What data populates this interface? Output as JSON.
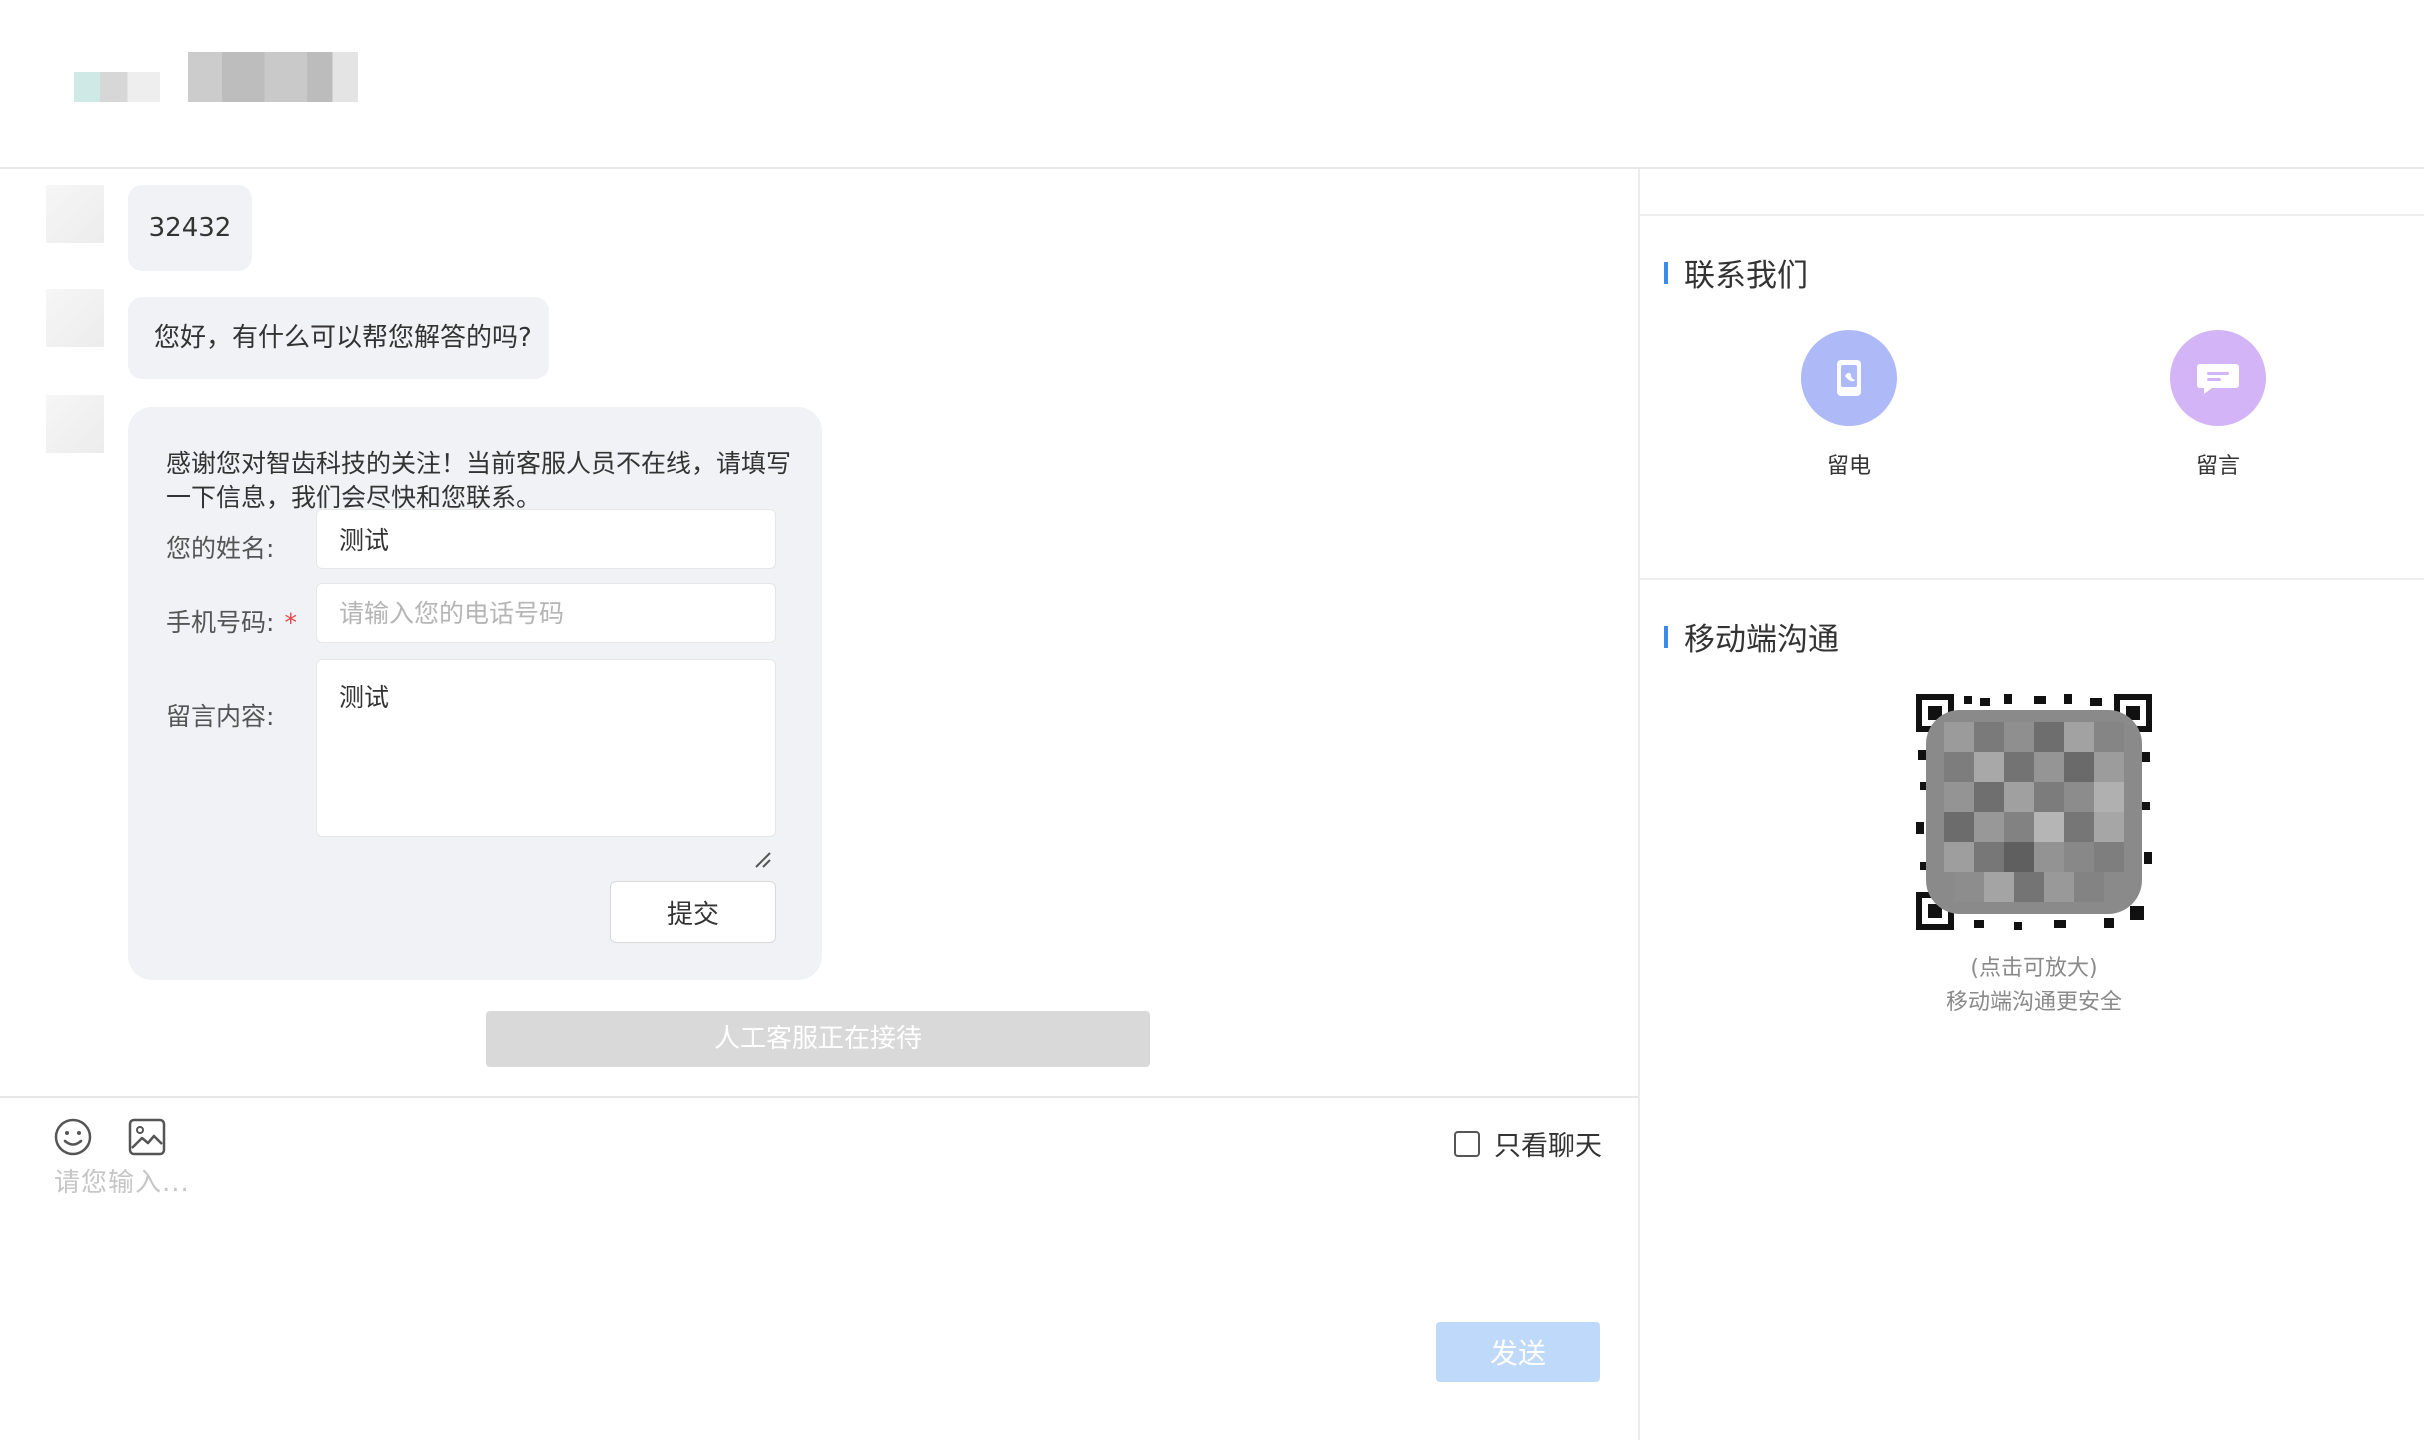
{
  "chat": {
    "messages": [
      {
        "text": "32432"
      },
      {
        "text": "您好，有什么可以帮您解答的吗?"
      }
    ],
    "form": {
      "intro": "感谢您对智齿科技的关注！当前客服人员不在线，请填写一下信息，我们会尽快和您联系。",
      "name_label": "您的姓名:",
      "name_value": "测试",
      "phone_label": "手机号码:",
      "phone_required_mark": "*",
      "phone_placeholder": "请输入您的电话号码",
      "content_label": "留言内容:",
      "content_value": "测试",
      "submit_label": "提交"
    },
    "queue_status": "人工客服正在接待"
  },
  "input": {
    "only_chat_label": "只看聊天",
    "placeholder": "请您输入...",
    "send_label": "发送"
  },
  "sidebar": {
    "contact_title": "联系我们",
    "contacts": [
      {
        "label": "留电",
        "icon": "phone-icon",
        "color": "#aebaf7"
      },
      {
        "label": "留言",
        "icon": "message-icon",
        "color": "#d3b5f7"
      }
    ],
    "mobile_title": "移动端沟通",
    "qr_tip_1": "(点击可放大)",
    "qr_tip_2": "移动端沟通更安全"
  },
  "colors": {
    "accent": "#3b8bea",
    "send_disabled": "#bfd9fb",
    "bubble_bg": "#f1f2f5"
  }
}
